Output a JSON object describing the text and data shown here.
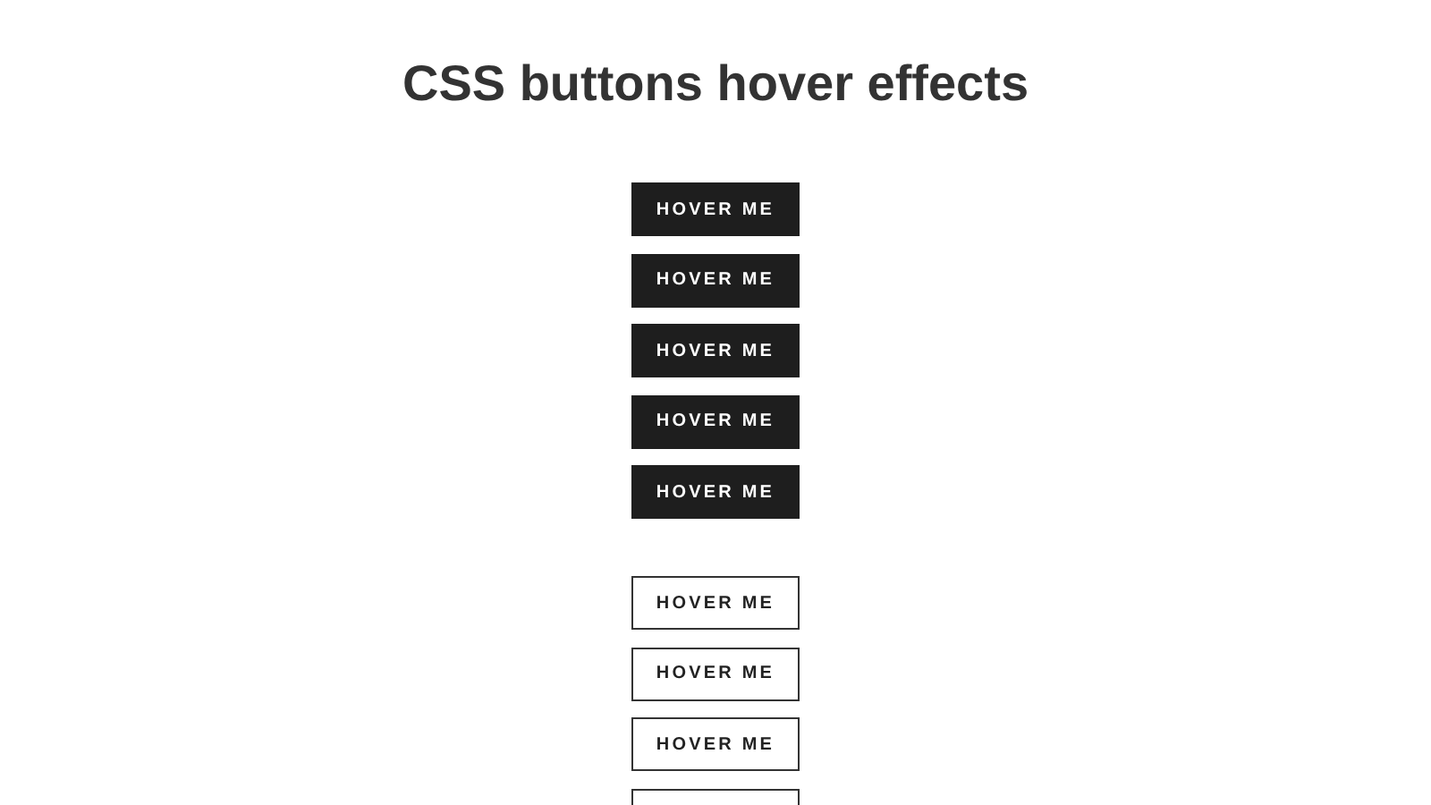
{
  "title": "CSS buttons hover effects",
  "groups": [
    {
      "kind": "dark",
      "buttons": [
        {
          "label": "HOVER ME"
        },
        {
          "label": "HOVER ME"
        },
        {
          "label": "HOVER ME"
        },
        {
          "label": "HOVER ME"
        },
        {
          "label": "HOVER ME"
        }
      ]
    },
    {
      "kind": "outline",
      "buttons": [
        {
          "label": "HOVER ME"
        },
        {
          "label": "HOVER ME"
        },
        {
          "label": "HOVER ME"
        },
        {
          "clipped": true
        }
      ]
    }
  ]
}
